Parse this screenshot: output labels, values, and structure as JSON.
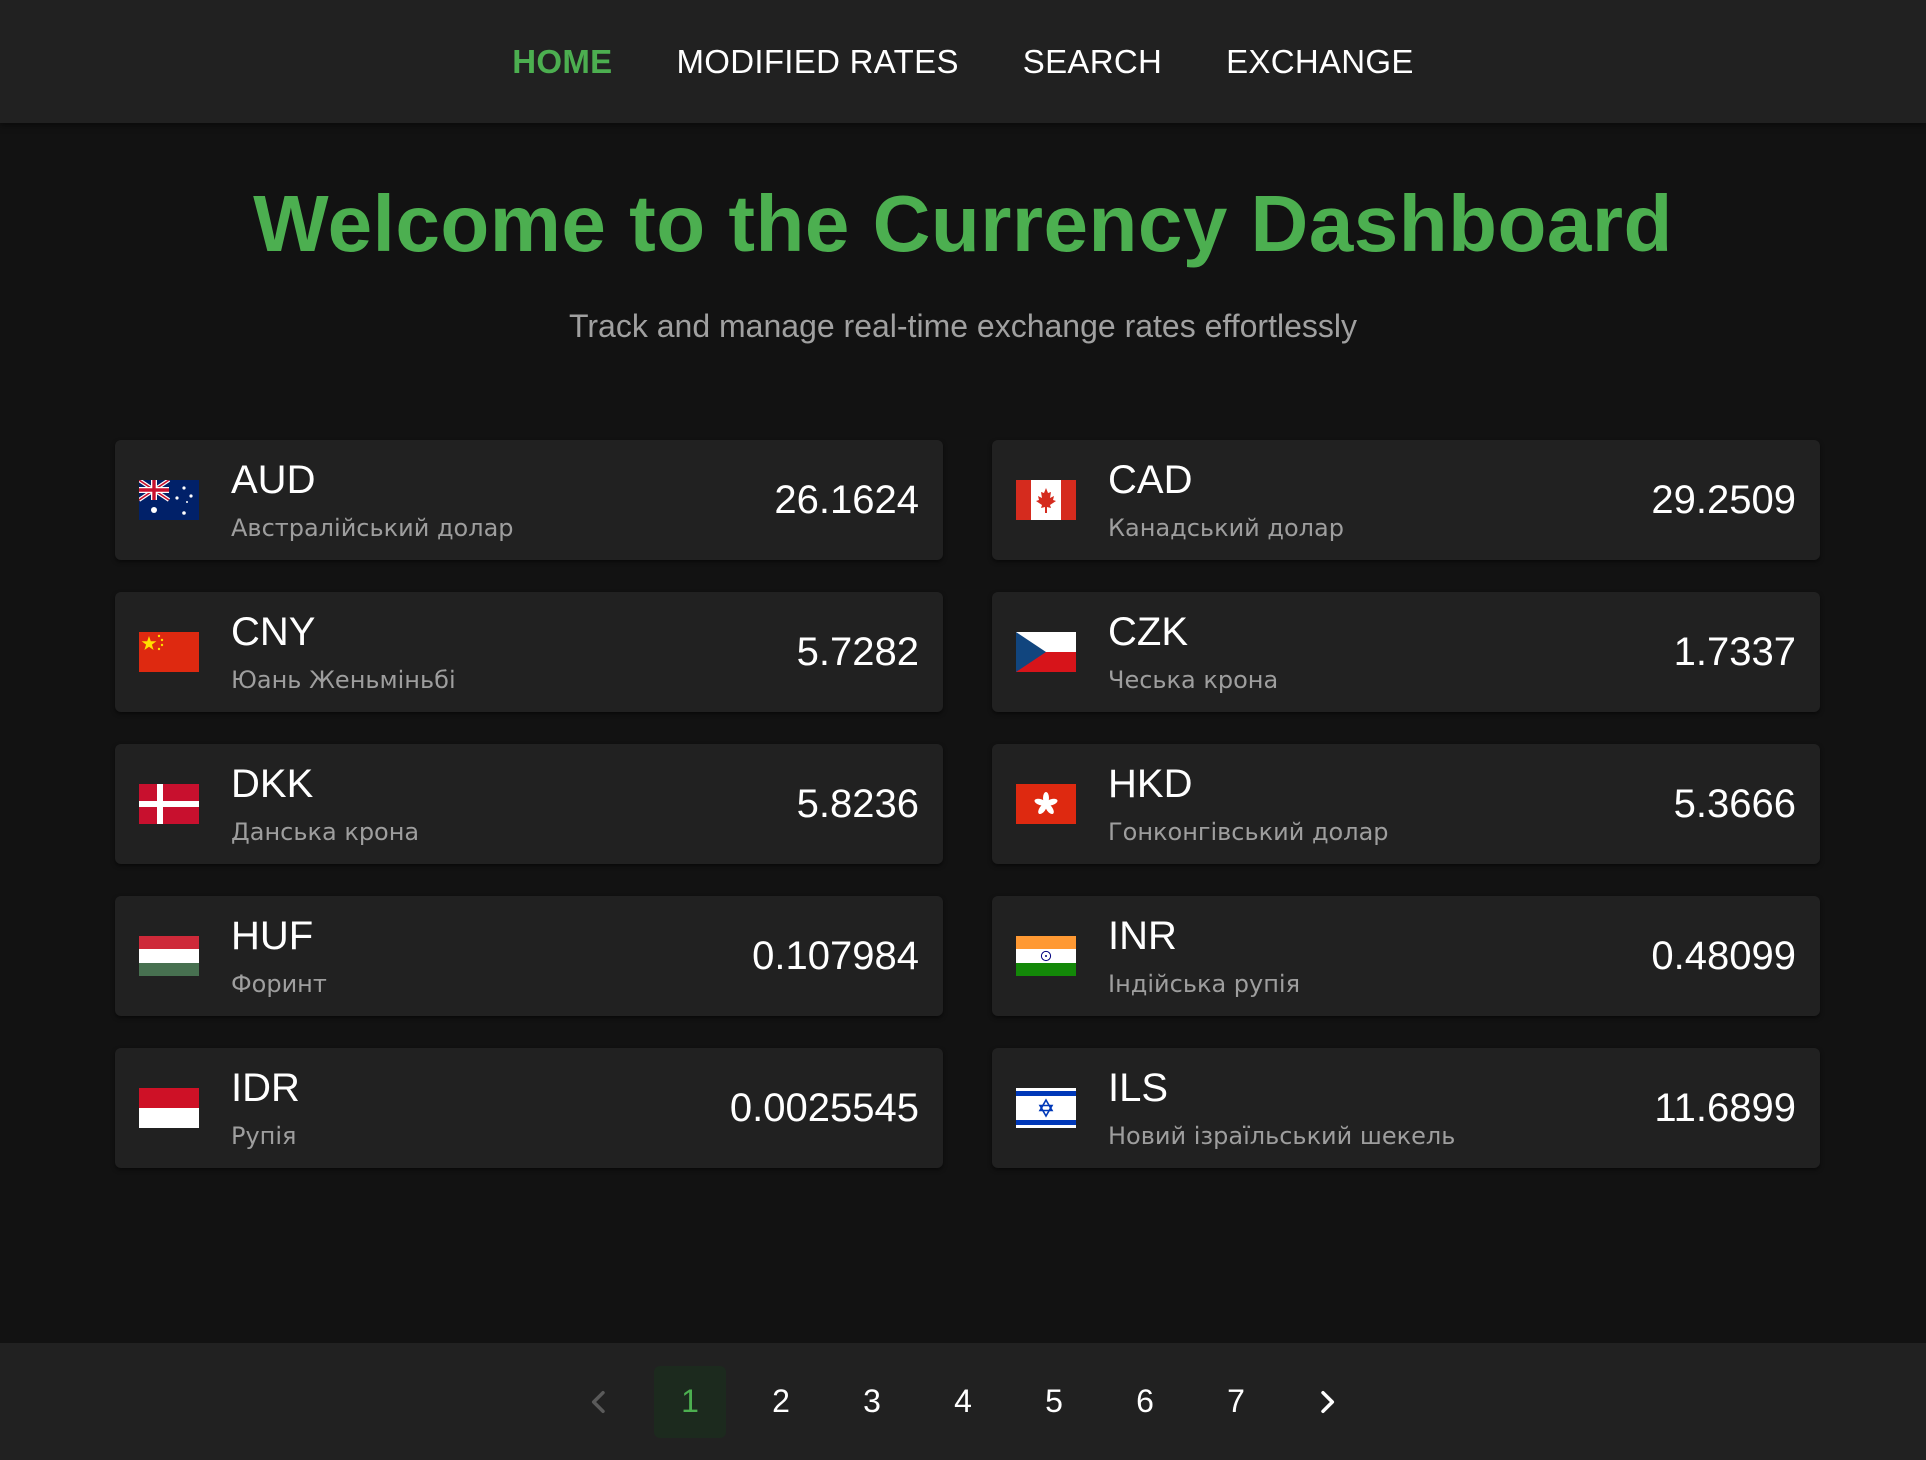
{
  "nav": {
    "items": [
      {
        "label": "HOME",
        "active": true
      },
      {
        "label": "MODIFIED RATES",
        "active": false
      },
      {
        "label": "SEARCH",
        "active": false
      },
      {
        "label": "EXCHANGE",
        "active": false
      }
    ]
  },
  "hero": {
    "title": "Welcome to the Currency Dashboard",
    "subtitle": "Track and manage real-time exchange rates effortlessly"
  },
  "currencies": [
    {
      "code": "AUD",
      "name": "Австралійський долар",
      "rate": "26.1624",
      "flag": "australia-flag-icon"
    },
    {
      "code": "CAD",
      "name": "Канадський долар",
      "rate": "29.2509",
      "flag": "canada-flag-icon"
    },
    {
      "code": "CNY",
      "name": "Юань Женьміньбі",
      "rate": "5.7282",
      "flag": "china-flag-icon"
    },
    {
      "code": "CZK",
      "name": "Чеська крона",
      "rate": "1.7337",
      "flag": "czech-flag-icon"
    },
    {
      "code": "DKK",
      "name": "Данська крона",
      "rate": "5.8236",
      "flag": "denmark-flag-icon"
    },
    {
      "code": "HKD",
      "name": "Гонконгівський долар",
      "rate": "5.3666",
      "flag": "hong-kong-flag-icon"
    },
    {
      "code": "HUF",
      "name": "Форинт",
      "rate": "0.107984",
      "flag": "hungary-flag-icon"
    },
    {
      "code": "INR",
      "name": "Індійська рупія",
      "rate": "0.48099",
      "flag": "india-flag-icon"
    },
    {
      "code": "IDR",
      "name": "Рупія",
      "rate": "0.0025545",
      "flag": "indonesia-flag-icon"
    },
    {
      "code": "ILS",
      "name": "Новий ізраїльський шекель",
      "rate": "11.6899",
      "flag": "israel-flag-icon"
    }
  ],
  "pagination": {
    "pages": [
      "1",
      "2",
      "3",
      "4",
      "5",
      "6",
      "7"
    ],
    "current": "1",
    "prev_icon": "chevron-left-icon",
    "next_icon": "chevron-right-icon"
  },
  "colors": {
    "accent": "#4caf50",
    "background": "#121212",
    "surface": "#212121",
    "muted_text": "#9e9e9e"
  }
}
